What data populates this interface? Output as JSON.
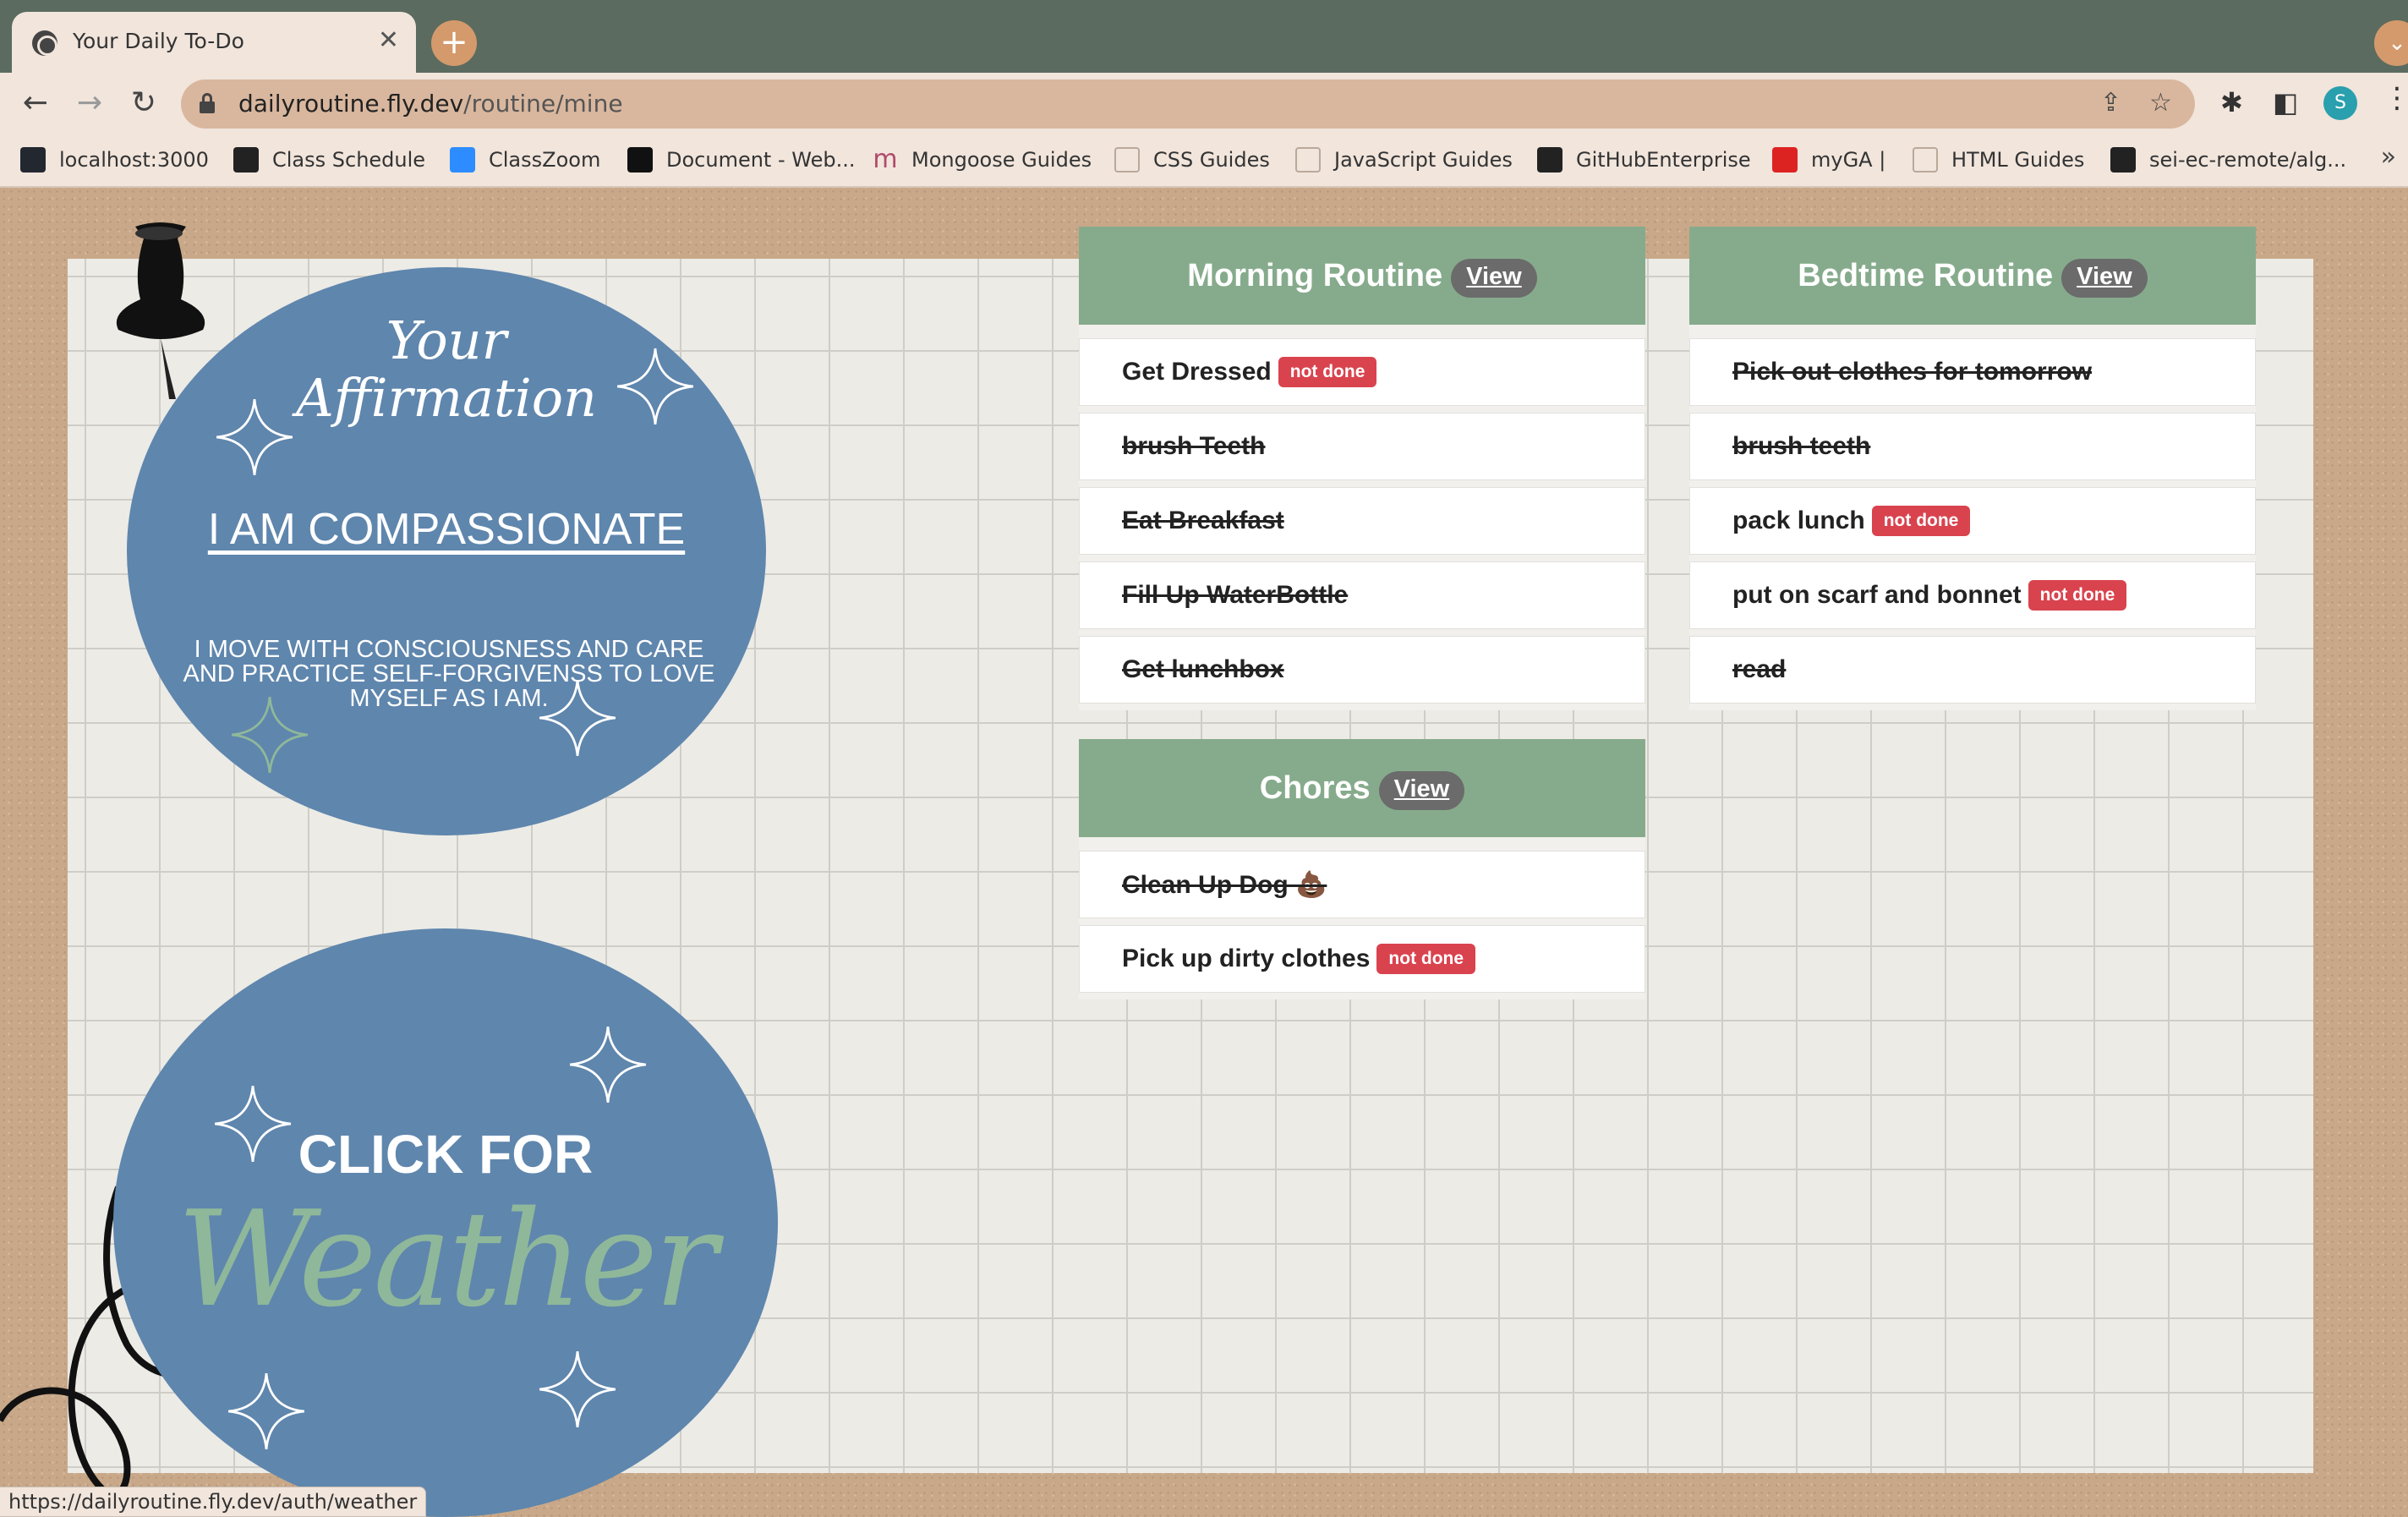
{
  "browser": {
    "tab_title": "Your Daily To-Do",
    "tab_close": "✕",
    "new_tab": "+",
    "tab_menu": "⌄",
    "url_host": "dailyroutine.fly.dev",
    "url_path": "/routine/mine",
    "profile_initial": "S",
    "status_url": "https://dailyroutine.fly.dev/auth/weather"
  },
  "bookmarks": [
    {
      "label": "localhost:3000",
      "icon": "react-icon"
    },
    {
      "label": "Class Schedule",
      "icon": "github-icon"
    },
    {
      "label": "ClassZoom",
      "icon": "zoom-icon"
    },
    {
      "label": "Document - Web...",
      "icon": "document-icon"
    },
    {
      "label": "Mongoose Guides",
      "icon": "mongoose-icon"
    },
    {
      "label": "CSS Guides",
      "icon": "folder-icon"
    },
    {
      "label": "JavaScript Guides",
      "icon": "folder-icon"
    },
    {
      "label": "GitHubEnterprise",
      "icon": "github-icon"
    },
    {
      "label": "myGA |",
      "icon": "ga-icon"
    },
    {
      "label": "HTML Guides",
      "icon": "folder-icon"
    },
    {
      "label": "sei-ec-remote/alg...",
      "icon": "github-icon"
    }
  ],
  "affirmation": {
    "heading_line1": "Your",
    "heading_line2": "Affirmation",
    "word": "I AM COMPASSIONATE",
    "description": "I MOVE WITH CONSCIOUSNESS AND CARE AND PRACTICE SELF-FORGIVENSS TO LOVE MYSELF AS I AM."
  },
  "weather": {
    "click_text": "CLICK FOR",
    "big_text": "Weather"
  },
  "routines": {
    "morning": {
      "title": "Morning Routine",
      "view_label": "View",
      "items": [
        {
          "text": "Get Dressed",
          "status": "not done",
          "done": false
        },
        {
          "text": "brush Teeth",
          "done": true
        },
        {
          "text": "Eat Breakfast",
          "done": true
        },
        {
          "text": "Fill Up WaterBottle",
          "done": true
        },
        {
          "text": "Get lunchbox",
          "done": true
        }
      ]
    },
    "bedtime": {
      "title": "Bedtime Routine",
      "view_label": "View",
      "items": [
        {
          "text": "Pick out clothes for tomorrow",
          "done": true
        },
        {
          "text": "brush teeth",
          "done": true
        },
        {
          "text": "pack lunch",
          "status": "not done",
          "done": false
        },
        {
          "text": "put on scarf and bonnet",
          "status": "not done",
          "done": false
        },
        {
          "text": "read",
          "done": true
        }
      ]
    },
    "chores": {
      "title": "Chores",
      "view_label": "View",
      "items": [
        {
          "text": "Clean Up Dog 💩",
          "done": true
        },
        {
          "text": "Pick up dirty clothes",
          "status": "not done",
          "done": false
        }
      ]
    }
  },
  "colors": {
    "card_header": "#86ab8c",
    "circle_blue": "#5f86ad",
    "badge_red": "#d9434e"
  }
}
